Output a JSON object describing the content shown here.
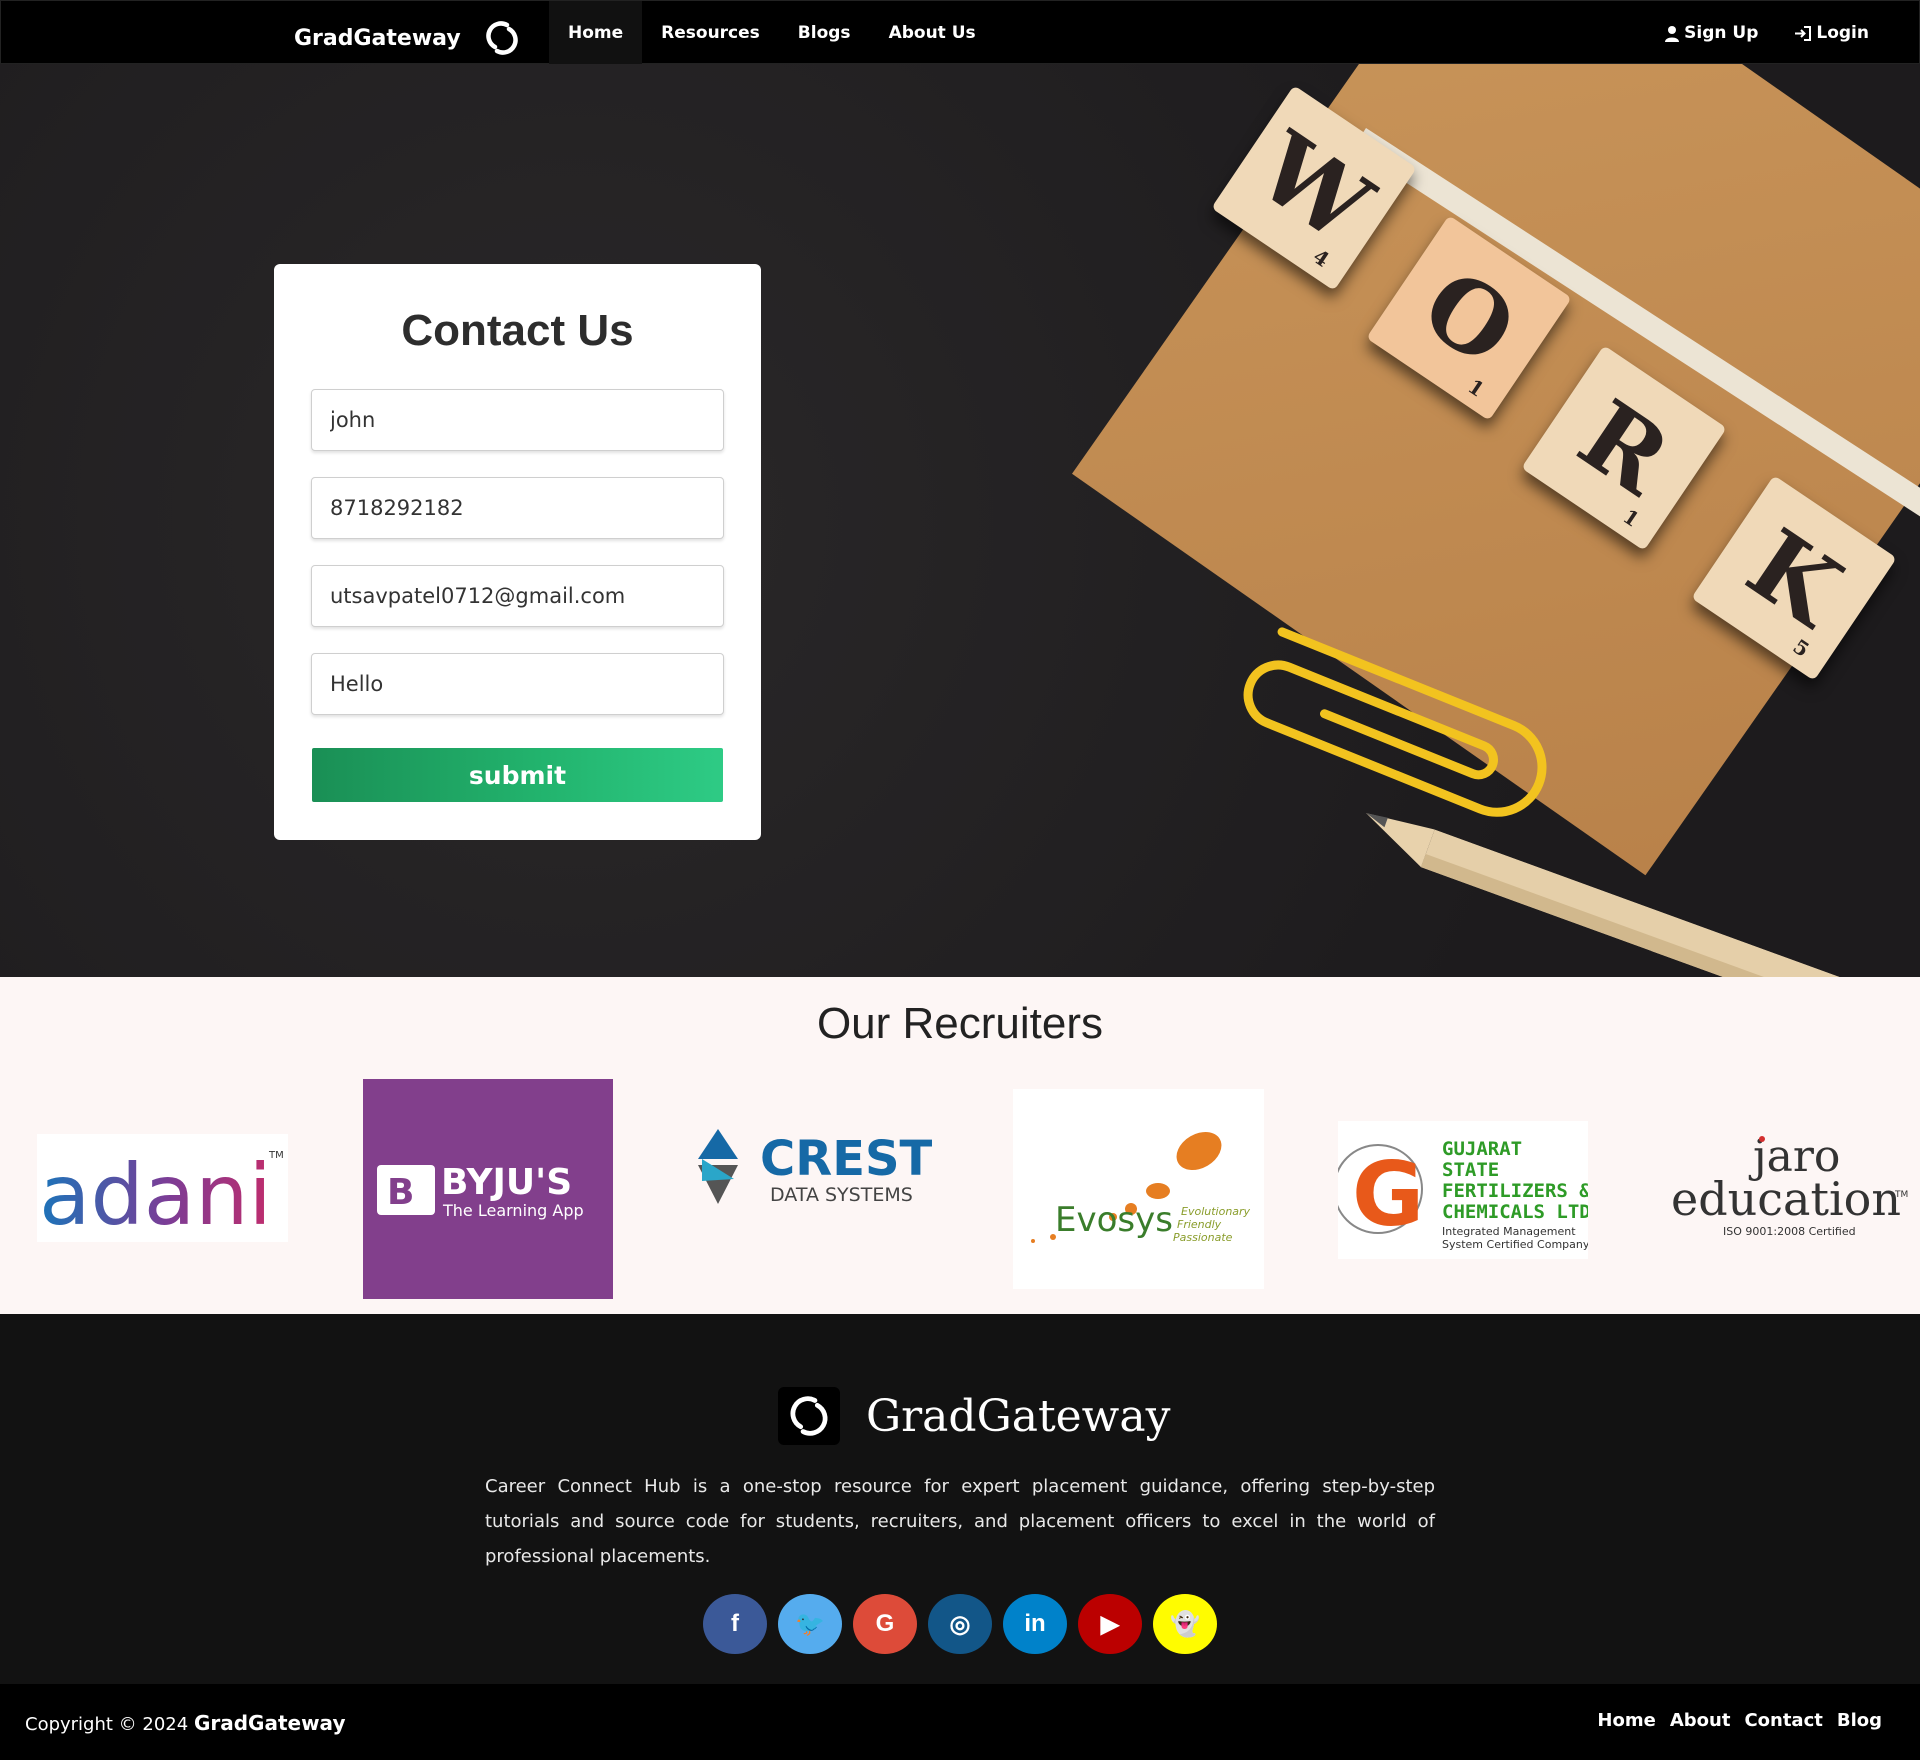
{
  "navbar": {
    "brand": "GradGateway",
    "links": [
      {
        "label": "Home",
        "active": true
      },
      {
        "label": "Resources"
      },
      {
        "label": "Blogs"
      },
      {
        "label": "About Us"
      }
    ],
    "signup": "Sign Up",
    "login": "Login"
  },
  "hero": {
    "tiles": [
      {
        "letter": "W",
        "score": "4"
      },
      {
        "letter": "O",
        "score": "1"
      },
      {
        "letter": "R",
        "score": "1"
      },
      {
        "letter": "K",
        "score": "5"
      }
    ]
  },
  "contact": {
    "title": "Contact Us",
    "name_value": "john",
    "phone_value": "8718292182",
    "email_value": "utsavpatel0712@gmail.com",
    "message_value": "Hello",
    "submit_label": "submit"
  },
  "recruiters": {
    "title": "Our Recruiters",
    "logos": {
      "adani": {
        "name": "adani",
        "tm": "TM"
      },
      "byjus": {
        "name": "BYJU'S",
        "tagline": "The Learning App"
      },
      "crest": {
        "name": "CREST",
        "sub": "DATA SYSTEMS"
      },
      "evosys": {
        "name": "Evosys",
        "tagline1": "Evolutionary",
        "tagline2": "Friendly",
        "tagline3": "Passionate"
      },
      "gsfc": {
        "line1": "GUJARAT",
        "line2": "STATE",
        "line3": "FERTILIZERS &",
        "line4": "CHEMICALS LTD.",
        "line5": "Integrated Management",
        "line6": "System Certified Company"
      },
      "jaro": {
        "line1": "jaro",
        "line2": "education",
        "tm": "TM",
        "cert": "ISO 9001:2008 Certified"
      }
    }
  },
  "footer": {
    "brand": "GradGateway",
    "description": "Career Connect Hub is a one-stop resource for expert placement guidance, offering step-by-step tutorials and source code for students, recruiters, and placement officers to excel in the world of professional placements.",
    "socials": [
      {
        "name": "facebook",
        "glyph": "f",
        "color": "#3b5998"
      },
      {
        "name": "twitter",
        "glyph": "🐦",
        "color": "#55acee"
      },
      {
        "name": "google",
        "glyph": "G",
        "color": "#dd4b39"
      },
      {
        "name": "instagram",
        "glyph": "◎",
        "color": "#125688"
      },
      {
        "name": "linkedin",
        "glyph": "in",
        "color": "#0082ca"
      },
      {
        "name": "youtube",
        "glyph": "▶",
        "color": "#bb0000"
      },
      {
        "name": "snapchat",
        "glyph": "👻",
        "color": "#fffc00"
      }
    ]
  },
  "bottom": {
    "copyright_prefix": "Copyright © 2024",
    "copyright_brand": "GradGateway",
    "links": [
      "Home",
      "About",
      "Contact",
      "Blog"
    ]
  },
  "colors": {
    "accent_green": "#22b36d",
    "byjus_purple": "#823f8c",
    "nav_bg": "#000000"
  }
}
